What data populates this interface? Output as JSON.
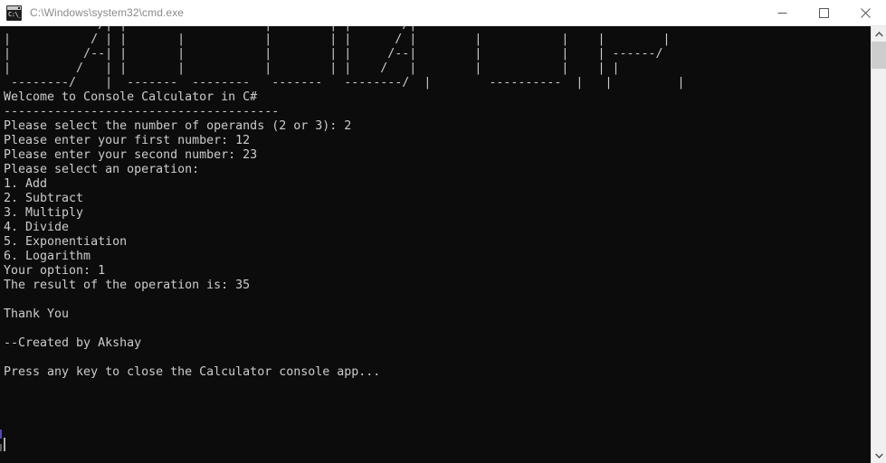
{
  "window": {
    "title": "C:\\Windows\\system32\\cmd.exe",
    "icon_text": "C:\\_",
    "background_color": "#0c0c0c",
    "text_color": "#cccccc",
    "titlebar_color": "#ffffff",
    "titlebar_text_color": "#8a8a8a"
  },
  "controls": {
    "minimize_label": "Minimize",
    "maximize_label": "Maximize",
    "close_label": "Close"
  },
  "scrollbar": {
    "up_arrow_label": "Scroll up",
    "down_arrow_label": "Scroll down",
    "thumb_label": "Scroll thumb"
  },
  "console": {
    "banner": " --------    /| |       --------    |        | |       /|  --------   ----------  ---------\n|           / | |       |           |        | |      / |        |           |    |        |\n|          /--| |       |           |        | |     /--|        |           |    | ------/\n|         /   | |       |           |        | |    /   |        |           |    | |\n --------/    |  -------  --------   -------   --------/  |        ----------  |   |         |",
    "lines": [
      "Welcome to Console Calculator in C#",
      "--------------------------------------",
      "Please select the number of operands (2 or 3): 2",
      "Please enter your first number: 12",
      "Please enter your second number: 23",
      "Please select an operation:",
      "1. Add",
      "2. Subtract",
      "3. Multiply",
      "4. Divide",
      "5. Exponentiation",
      "6. Logarithm",
      "Your option: 1",
      "The result of the operation is: 35",
      "",
      "Thank You",
      "",
      "--Created by Akshay",
      "",
      "Press any key to close the Calculator console app..."
    ],
    "app_title": "Welcome to Console Calculator in C#",
    "divider": "--------------------------------------",
    "prompt_operands": "Please select the number of operands (2 or 3): 2",
    "prompt_first": "Please enter your first number: 12",
    "prompt_second": "Please enter your second number: 23",
    "prompt_operation": "Please select an operation:",
    "menu": [
      "1. Add",
      "2. Subtract",
      "3. Multiply",
      "4. Divide",
      "5. Exponentiation",
      "6. Logarithm"
    ],
    "your_option": "Your option: 1",
    "result": "The result of the operation is: 35",
    "thanks": "Thank You",
    "credit": "--Created by Akshay",
    "exit_prompt": "Press any key to close the Calculator console app...",
    "values": {
      "operand_count": "2",
      "first_number": "12",
      "second_number": "23",
      "selected_operation": "1",
      "result_value": "35"
    },
    "bottom_partial": ".... ........"
  }
}
